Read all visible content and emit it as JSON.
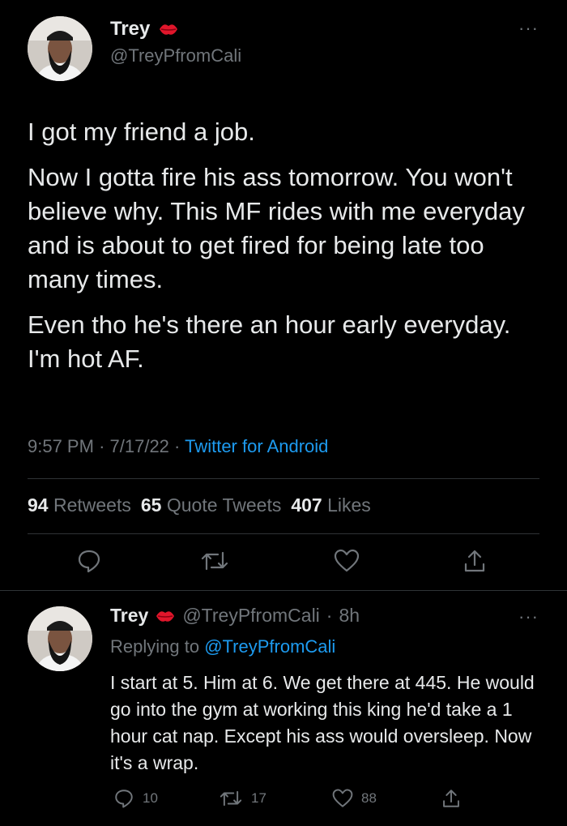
{
  "main_tweet": {
    "name": "Trey",
    "handle": "@TreyPfromCali",
    "paragraphs": [
      "I got my friend a job.",
      "Now I gotta fire his ass tomorrow. You won't believe why. This MF rides with me everyday and is about to get fired for being late too many times.",
      "Even tho he's there an hour early everyday. I'm hot AF."
    ],
    "time": "9:57 PM",
    "date": "7/17/22",
    "source": "Twitter for Android",
    "stats": {
      "retweets_count": "94",
      "retweets_label": "Retweets",
      "quotes_count": "65",
      "quotes_label": "Quote Tweets",
      "likes_count": "407",
      "likes_label": "Likes"
    }
  },
  "reply": {
    "name": "Trey",
    "handle": "@TreyPfromCali",
    "time_ago": "8h",
    "replying_prefix": "Replying to",
    "replying_handle": "@TreyPfromCali",
    "text": "I start at 5. Him at 6. We get there at 445. He would go into the gym at working this king he'd take a 1 hour cat nap. Except his ass would oversleep. Now it's a wrap.",
    "reply_count": "10",
    "retweet_count": "17",
    "like_count": "88"
  },
  "icons": {
    "more": "more-dots-icon",
    "emoji": "kiss-lips-emoji",
    "reply": "reply-icon",
    "retweet": "retweet-icon",
    "like": "heart-icon",
    "share": "share-icon"
  },
  "colors": {
    "background": "#000000",
    "text": "#e7e9ea",
    "muted": "#71767b",
    "link": "#1d9bf0",
    "divider": "#2f3336"
  }
}
